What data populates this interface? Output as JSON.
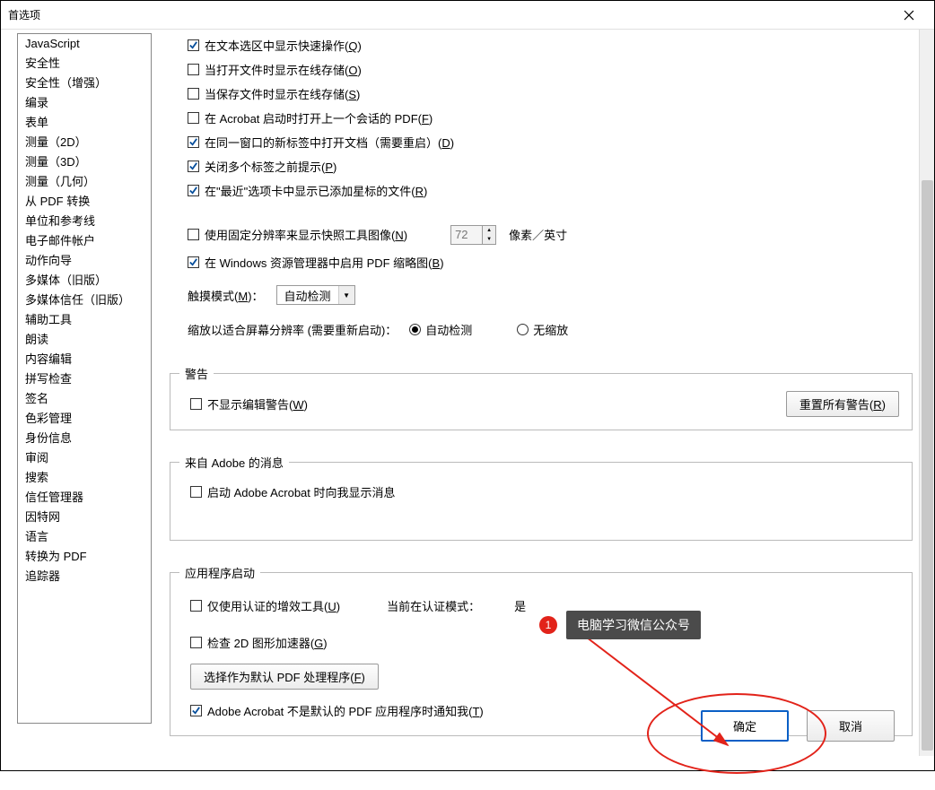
{
  "title": "首选项",
  "sidebar": {
    "items": [
      {
        "label": "JavaScript"
      },
      {
        "label": "安全性"
      },
      {
        "label": "安全性（增强）"
      },
      {
        "label": "编录"
      },
      {
        "label": "表单"
      },
      {
        "label": "测量（2D）"
      },
      {
        "label": "测量（3D）"
      },
      {
        "label": "测量（几何）"
      },
      {
        "label": "从 PDF 转换"
      },
      {
        "label": "单位和参考线"
      },
      {
        "label": "电子邮件帐户"
      },
      {
        "label": "动作向导"
      },
      {
        "label": "多媒体（旧版）"
      },
      {
        "label": "多媒体信任（旧版）"
      },
      {
        "label": "辅助工具"
      },
      {
        "label": "朗读"
      },
      {
        "label": "内容编辑"
      },
      {
        "label": "拼写检查"
      },
      {
        "label": "签名"
      },
      {
        "label": "色彩管理"
      },
      {
        "label": "身份信息"
      },
      {
        "label": "审阅"
      },
      {
        "label": "搜索"
      },
      {
        "label": "信任管理器"
      },
      {
        "label": "因特网"
      },
      {
        "label": "语言"
      },
      {
        "label": "转换为 PDF"
      },
      {
        "label": "追踪器"
      }
    ]
  },
  "options": {
    "chk1": {
      "checked": true,
      "pre": "在文本选区中显示快速操作(",
      "key": "Q",
      "post": ")"
    },
    "chk2": {
      "checked": false,
      "pre": "当打开文件时显示在线存储(",
      "key": "O",
      "post": ")"
    },
    "chk3": {
      "checked": false,
      "pre": "当保存文件时显示在线存储(",
      "key": "S",
      "post": ")"
    },
    "chk4": {
      "checked": false,
      "pre": "在 Acrobat 启动时打开上一个会话的 PDF(",
      "key": "F",
      "post": ")"
    },
    "chk5": {
      "checked": true,
      "pre": "在同一窗口的新标签中打开文档（需要重启）(",
      "key": "D",
      "post": ")"
    },
    "chk6": {
      "checked": true,
      "pre": "关闭多个标签之前提示(",
      "key": "P",
      "post": ")"
    },
    "chk7": {
      "checked": true,
      "pre": "在\"最近\"选项卡中显示已添加星标的文件(",
      "key": "R",
      "post": ")"
    },
    "chk8": {
      "checked": false,
      "pre": "使用固定分辨率来显示快照工具图像(",
      "key": "N",
      "post": ")"
    },
    "chk9": {
      "checked": true,
      "pre": "在 Windows 资源管理器中启用 PDF 缩略图(",
      "key": "B",
      "post": ")"
    },
    "resolution_value": "72",
    "resolution_unit": "像素／英寸",
    "touch_label_pre": "触摸模式(",
    "touch_key": "M",
    "touch_label_post": ")：",
    "touch_select": "自动检测",
    "zoom_label": "缩放以适合屏幕分辨率 (需要重新启动)：",
    "zoom_r1": "自动检测",
    "zoom_r2": "无缩放"
  },
  "warning": {
    "legend": "警告",
    "chk": {
      "checked": false,
      "pre": "不显示编辑警告(",
      "key": "W",
      "post": ")"
    },
    "reset_pre": "重置所有警告(",
    "reset_key": "R",
    "reset_post": ")"
  },
  "adobe_msg": {
    "legend": "来自 Adobe 的消息",
    "chk": {
      "checked": false,
      "label": "启动 Adobe Acrobat 时向我显示消息"
    }
  },
  "app_start": {
    "legend": "应用程序启动",
    "chk1": {
      "checked": false,
      "pre": "仅使用认证的增效工具(",
      "key": "U",
      "post": ")"
    },
    "auth_label": "当前在认证模式：",
    "auth_value": "是",
    "chk2": {
      "checked": false,
      "pre": "检查 2D 图形加速器(",
      "key": "G",
      "post": ")"
    },
    "default_btn_pre": "选择作为默认 PDF 处理程序(",
    "default_btn_key": "F",
    "default_btn_post": ")",
    "chk3": {
      "checked": true,
      "pre": "Adobe Acrobat 不是默认的 PDF 应用程序时通知我(",
      "key": "T",
      "post": ")"
    }
  },
  "footer": {
    "ok": "确定",
    "cancel": "取消"
  },
  "annotation": {
    "num": "1",
    "label": "电脑学习微信公众号"
  }
}
